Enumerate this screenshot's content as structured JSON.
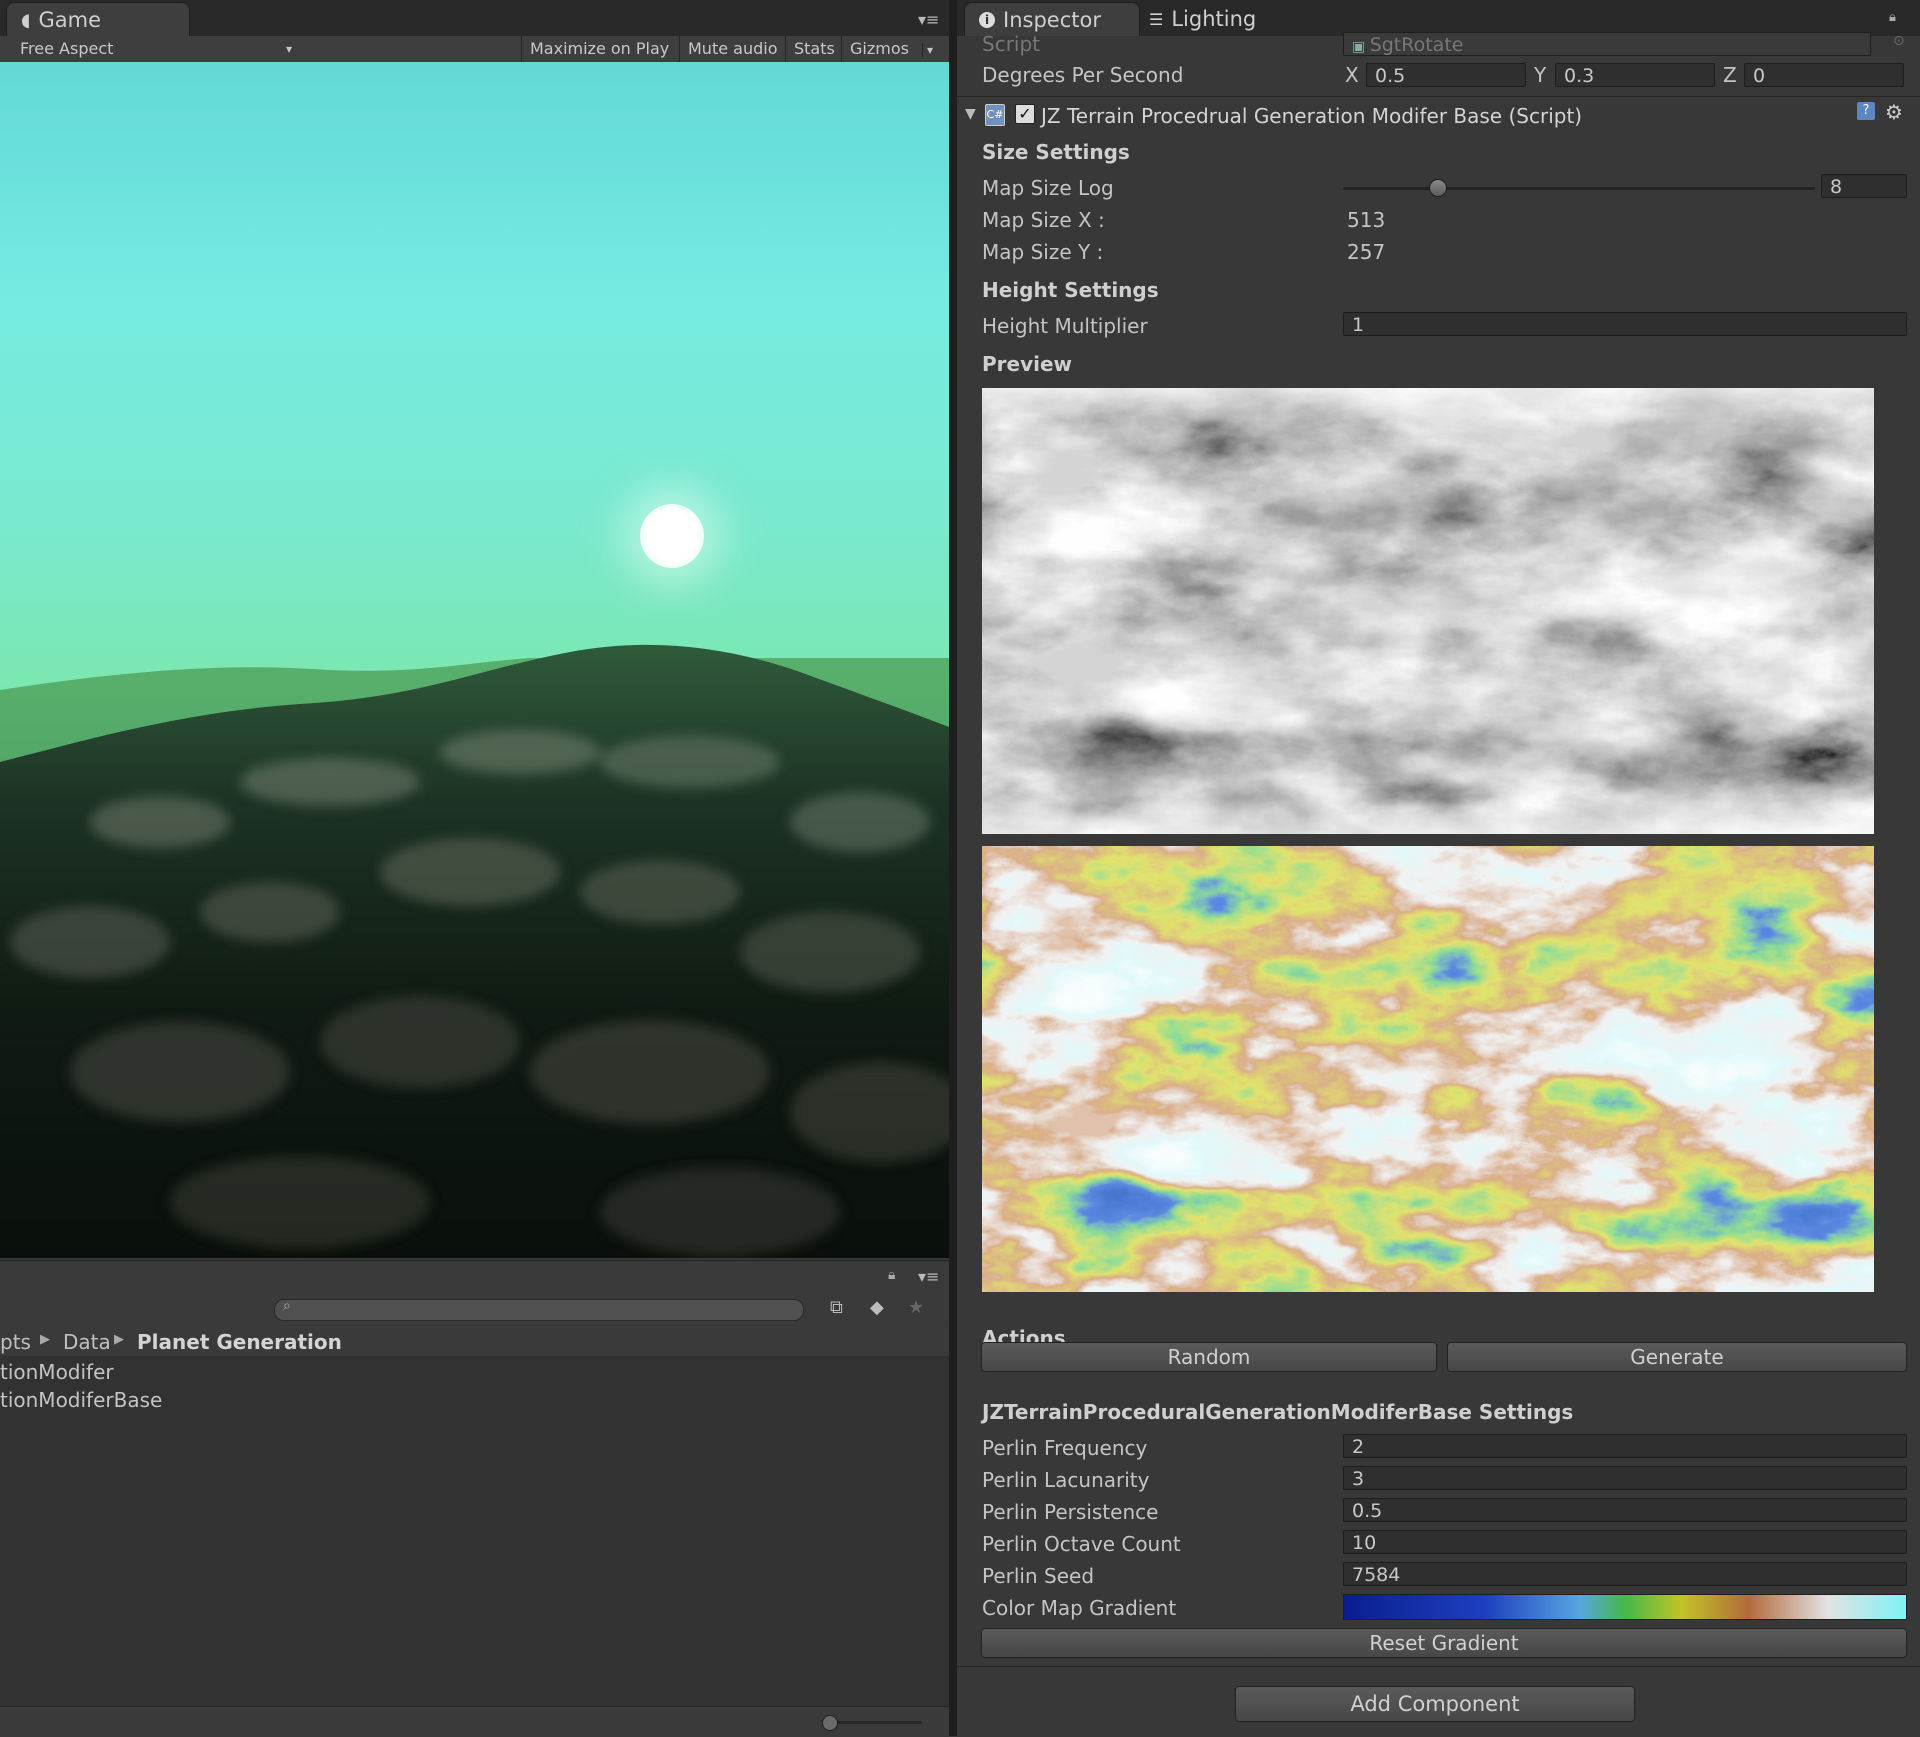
{
  "game_panel": {
    "tab_label": "Game",
    "aspect": "Free Aspect",
    "toolbar": {
      "maximize": "Maximize on Play",
      "mute": "Mute audio",
      "stats": "Stats",
      "gizmos": "Gizmos"
    }
  },
  "project_panel": {
    "breadcrumb": [
      "pts",
      "Data",
      "Planet Generation"
    ],
    "items": [
      "tionModifer",
      "tionModiferBase"
    ]
  },
  "inspector": {
    "tabs": [
      "Inspector",
      "Lighting"
    ],
    "script_label": "Script",
    "script_value": "SgtRotate",
    "degrees_label": "Degrees Per Second",
    "degrees": {
      "x_label": "X",
      "x": "0.5",
      "y_label": "Y",
      "y": "0.3",
      "z_label": "Z",
      "z": "0"
    },
    "component_title": "JZ Terrain Procedrual Generation Modifer Base (Script)",
    "size_settings": "Size Settings",
    "map_size_log_label": "Map Size Log",
    "map_size_log_value": "8",
    "map_size_log_fraction": 0.2,
    "map_size_x_label": "Map Size X :",
    "map_size_x": "513",
    "map_size_y_label": "Map Size Y :",
    "map_size_y": "257",
    "height_settings": "Height Settings",
    "height_mult_label": "Height Multiplier",
    "height_mult": "1",
    "preview_label": "Preview",
    "actions_label": "Actions",
    "random_btn": "Random",
    "generate_btn": "Generate",
    "settings_header": "JZTerrainProceduralGenerationModiferBase Settings",
    "fields": [
      {
        "label": "Perlin Frequency",
        "value": "2"
      },
      {
        "label": "Perlin Lacunarity",
        "value": "3"
      },
      {
        "label": "Perlin Persistence",
        "value": "0.5"
      },
      {
        "label": "Perlin Octave Count",
        "value": "10"
      },
      {
        "label": "Perlin Seed",
        "value": "7584"
      }
    ],
    "gradient_label": "Color Map Gradient",
    "reset_gradient_btn": "Reset Gradient",
    "add_component_btn": "Add Component"
  },
  "colors": {
    "gradient": [
      "#0a1e8e",
      "#1c3fbf",
      "#58a6e0",
      "#44b84a",
      "#c2c425",
      "#b36a3c",
      "#e2e2e2",
      "#7ff3f6"
    ]
  }
}
